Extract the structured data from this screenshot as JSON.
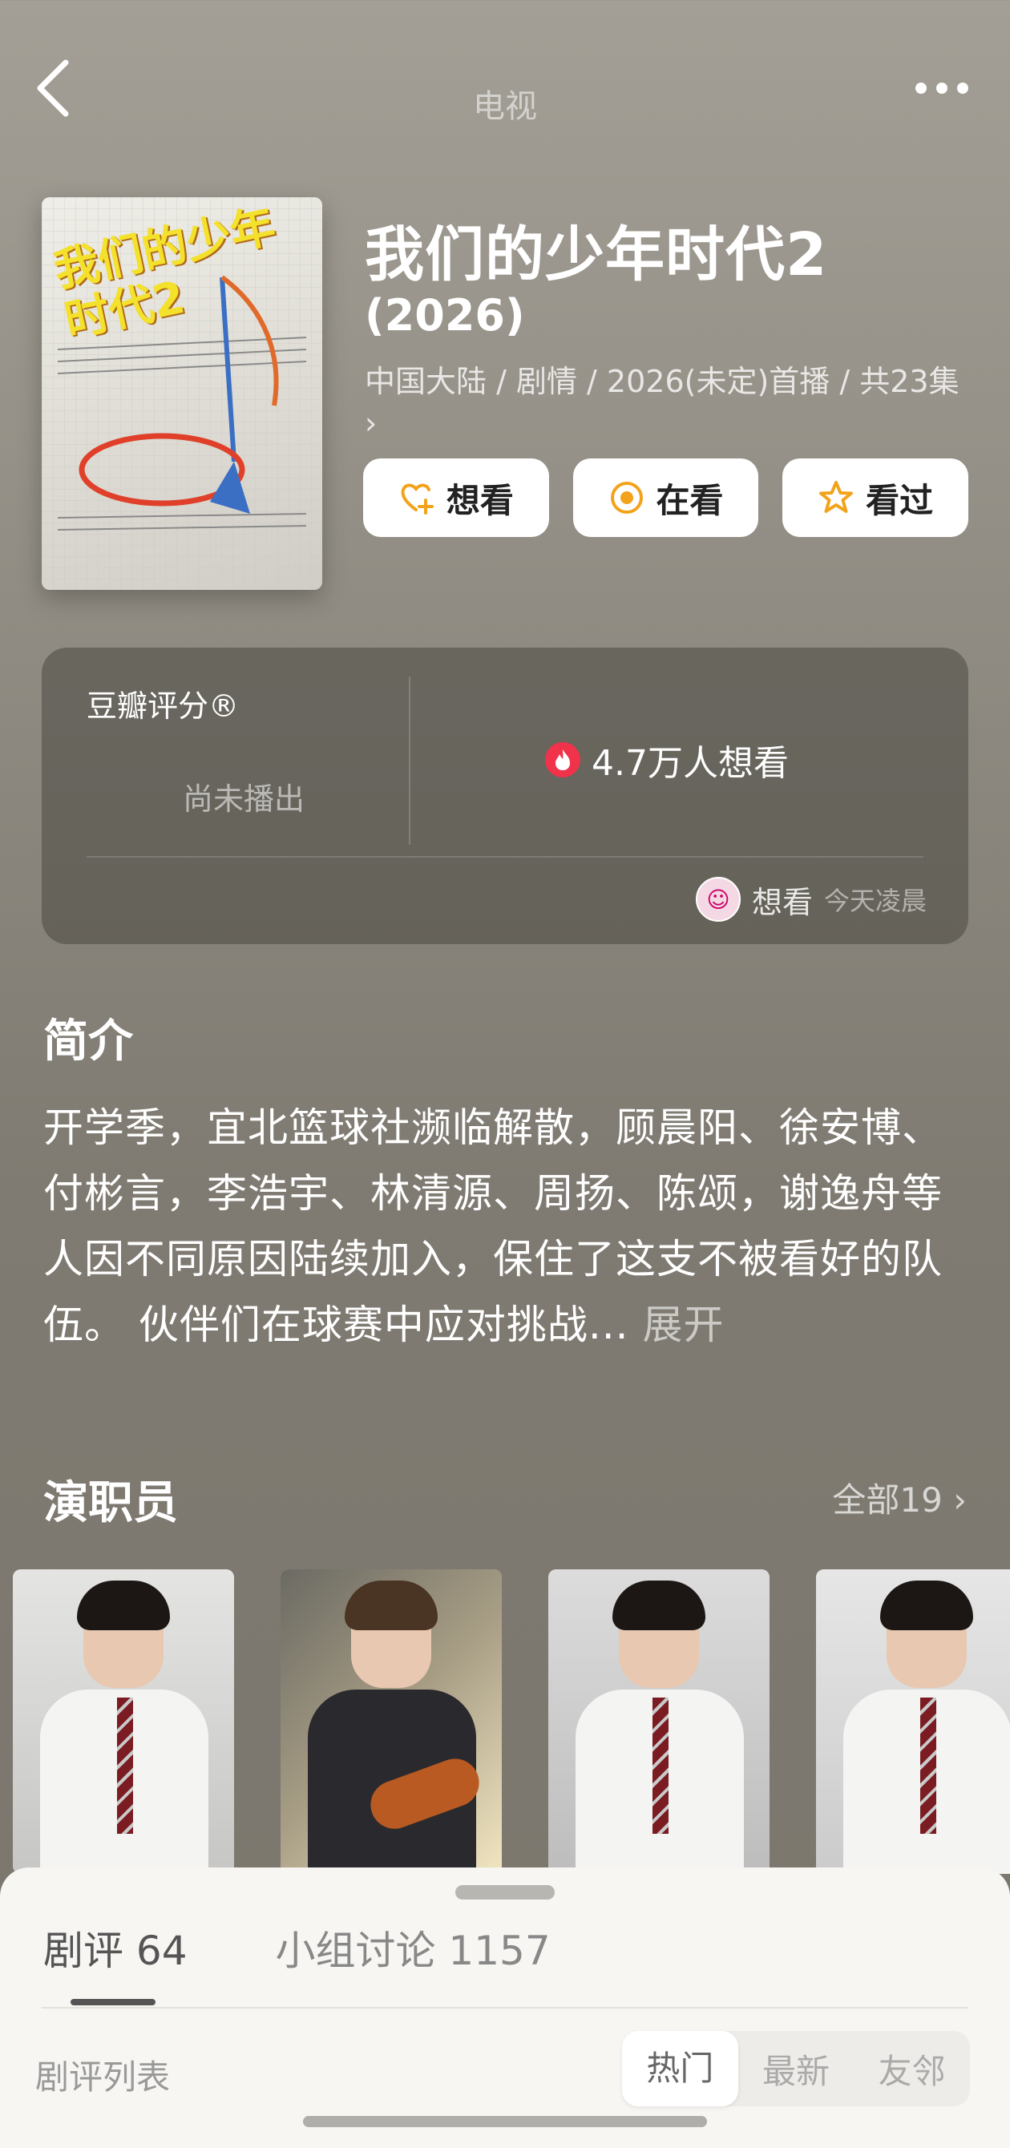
{
  "header": {
    "title": "电视"
  },
  "poster": {
    "title": "我们的少年时代2"
  },
  "subject": {
    "title": "我们的少年时代2",
    "year": "(2026)",
    "meta": "中国大陆 / 剧情 / 2026(未定)首播 / 共23集",
    "meta_more": "›"
  },
  "actions": {
    "want": "想看",
    "watching": "在看",
    "watched": "看过"
  },
  "rating": {
    "label": "豆瓣评分®",
    "status": "尚未播出",
    "want_count": "4.7万人想看",
    "friend_action": "想看",
    "friend_time": "今天凌晨"
  },
  "synopsis": {
    "title": "简介",
    "text": "开学季，宜北篮球社濒临解散，顾晨阳、徐安博、付彬言，李浩宇、林清源、周扬、陈颂，谢逸舟等人因不同原因陆续加入，保住了这支不被看好的队伍。 伙伴们在球赛中应对挑战...",
    "expand": "展开"
  },
  "cast": {
    "title": "演职员",
    "all": "全部19 ›"
  },
  "sheet": {
    "tabs": [
      "剧评 64",
      "小组讨论 1157"
    ],
    "list_label": "剧评列表",
    "sort": [
      "热门",
      "最新",
      "友邻"
    ]
  },
  "colors": {
    "accent_orange": "#f2a31b",
    "fire_red": "#f0324a"
  }
}
